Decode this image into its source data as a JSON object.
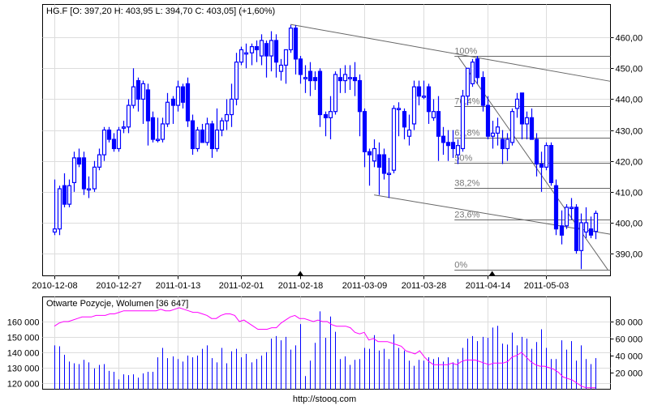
{
  "chart_data": [
    {
      "type": "candlestick",
      "title": "HG.F [O: 397,20  H: 403,95  L: 394,70  C: 403,05] (+1,60%)",
      "x_tick_labels": [
        "2010-12-08",
        "2010-12-27",
        "2011-01-13",
        "2011-02-01",
        "2011-02-18",
        "2011-03-09",
        "2011-03-28",
        "2011-04-14",
        "2011-05-03"
      ],
      "x_tick_index": [
        0,
        13,
        25,
        38,
        50,
        63,
        75,
        88,
        100
      ],
      "y_tick_labels": [
        "460,00",
        "450,00",
        "440,00",
        "430,00",
        "420,00",
        "410,00",
        "400,00",
        "390,00"
      ],
      "y_ticks": [
        460,
        450,
        440,
        430,
        420,
        410,
        400,
        390
      ],
      "ylim": [
        383,
        470
      ],
      "grid": true,
      "ohlc": [
        [
          397,
          414,
          396,
          398
        ],
        [
          398,
          412,
          396,
          411
        ],
        [
          412,
          416,
          405,
          406
        ],
        [
          406,
          414,
          405,
          412
        ],
        [
          413,
          423,
          410,
          421
        ],
        [
          421,
          424,
          418,
          419
        ],
        [
          421,
          423,
          409,
          411
        ],
        [
          411,
          415,
          408,
          411
        ],
        [
          411,
          420,
          410,
          418
        ],
        [
          418,
          424,
          417,
          422
        ],
        [
          422,
          431,
          420,
          430
        ],
        [
          430,
          431,
          426,
          427
        ],
        [
          427,
          429,
          423,
          424
        ],
        [
          424,
          431,
          423,
          430
        ],
        [
          431,
          433,
          429,
          431
        ],
        [
          431,
          440,
          429,
          438
        ],
        [
          438,
          450,
          437,
          444
        ],
        [
          446,
          447,
          436,
          440
        ],
        [
          440,
          446,
          432,
          445
        ],
        [
          443,
          445,
          425,
          433
        ],
        [
          434,
          436,
          426,
          427
        ],
        [
          427,
          434,
          426,
          427
        ],
        [
          427,
          434,
          426,
          432
        ],
        [
          432,
          442,
          431,
          439
        ],
        [
          440,
          441,
          432,
          438
        ],
        [
          438,
          446,
          436,
          444
        ],
        [
          444,
          445,
          437,
          439
        ],
        [
          445,
          447,
          431,
          433
        ],
        [
          433,
          435,
          422,
          424
        ],
        [
          424,
          431,
          423,
          430
        ],
        [
          430,
          432,
          426,
          426
        ],
        [
          426,
          434,
          425,
          432
        ],
        [
          432,
          433,
          421,
          424
        ],
        [
          424,
          437,
          423,
          430
        ],
        [
          430,
          434,
          428,
          433
        ],
        [
          433,
          440,
          430,
          435
        ],
        [
          435,
          445,
          431,
          440
        ],
        [
          440,
          455,
          438,
          452
        ],
        [
          452,
          457,
          451,
          456
        ],
        [
          455,
          458,
          450,
          455
        ],
        [
          455,
          458,
          451,
          457
        ],
        [
          457,
          459,
          452,
          456
        ],
        [
          454,
          461,
          451,
          459
        ],
        [
          458,
          459,
          447,
          454
        ],
        [
          454,
          462,
          449,
          459
        ],
        [
          459,
          461,
          447,
          452
        ],
        [
          449,
          453,
          446,
          451
        ],
        [
          451,
          456,
          445,
          456
        ],
        [
          456,
          464,
          455,
          463
        ],
        [
          463,
          464,
          448,
          453
        ],
        [
          453,
          454,
          445,
          448
        ],
        [
          447,
          451,
          442,
          447
        ],
        [
          449,
          452,
          441,
          446
        ],
        [
          447,
          449,
          443,
          446
        ],
        [
          449,
          450,
          431,
          435
        ],
        [
          435,
          436,
          428,
          434
        ],
        [
          434,
          441,
          427,
          436
        ],
        [
          436,
          449,
          435,
          448
        ],
        [
          447,
          450,
          442,
          446
        ],
        [
          446,
          451,
          442,
          448
        ],
        [
          447,
          451,
          443,
          447
        ],
        [
          447,
          452,
          441,
          446
        ],
        [
          446,
          448,
          428,
          436
        ],
        [
          436,
          437,
          418,
          423
        ],
        [
          423,
          424,
          412,
          422
        ],
        [
          420,
          427,
          418,
          424
        ],
        [
          422,
          426,
          409,
          418
        ],
        [
          422,
          424,
          414,
          416
        ],
        [
          416,
          421,
          408,
          416
        ],
        [
          417,
          438,
          416,
          437
        ],
        [
          437,
          439,
          428,
          437
        ],
        [
          436,
          437,
          427,
          431
        ],
        [
          428,
          435,
          425,
          430
        ],
        [
          432,
          446,
          430,
          444
        ],
        [
          444,
          446,
          438,
          441
        ],
        [
          441,
          446,
          440,
          441
        ],
        [
          444,
          445,
          432,
          436
        ],
        [
          434,
          440,
          433,
          436
        ],
        [
          436,
          441,
          420,
          428
        ],
        [
          428,
          431,
          422,
          426
        ],
        [
          426,
          430,
          420,
          425
        ],
        [
          426,
          430,
          421,
          424
        ],
        [
          422,
          427,
          419,
          425
        ],
        [
          424,
          443,
          423,
          441
        ],
        [
          441,
          449,
          438,
          450
        ],
        [
          445,
          453,
          444,
          452
        ],
        [
          453,
          454,
          445,
          447
        ],
        [
          447,
          449,
          436,
          438
        ],
        [
          438,
          441,
          427,
          428
        ],
        [
          428,
          433,
          424,
          429
        ],
        [
          429,
          434,
          425,
          431
        ],
        [
          427,
          430,
          419,
          424
        ],
        [
          424,
          429,
          420,
          427
        ],
        [
          426,
          437,
          425,
          436
        ],
        [
          437,
          442,
          434,
          440
        ],
        [
          442,
          442,
          427,
          432
        ],
        [
          432,
          436,
          427,
          434
        ],
        [
          434,
          437,
          427,
          427
        ],
        [
          427,
          429,
          415,
          419
        ],
        [
          419,
          423,
          410,
          418
        ],
        [
          418,
          426,
          417,
          425
        ],
        [
          425,
          426,
          412,
          413
        ],
        [
          412,
          414,
          396,
          398
        ],
        [
          399,
          404,
          393,
          396
        ],
        [
          399,
          406,
          398,
          405
        ],
        [
          405,
          408,
          401,
          405
        ],
        [
          405,
          406,
          390,
          391
        ],
        [
          391,
          403,
          385,
          400
        ],
        [
          397,
          405,
          395,
          400
        ],
        [
          398,
          402,
          395,
          396
        ],
        [
          397.2,
          403.95,
          394.7,
          403.05
        ]
      ],
      "trend_lines": [
        {
          "name": "upper-channel",
          "from": [
            48,
            464.2
          ],
          "to": [
            113,
            445.8
          ]
        },
        {
          "name": "lower-channel",
          "from": [
            65,
            409
          ],
          "to": [
            113,
            396.3
          ]
        },
        {
          "name": "fib-diagonal",
          "from": [
            82,
            454
          ],
          "to": [
            112.5,
            384.8
          ]
        }
      ],
      "fibonacci": {
        "from_index": 82,
        "levels": [
          {
            "label": "100%",
            "price": 454
          },
          {
            "label": "76,4%",
            "price": 437.7
          },
          {
            "label": "61,8%",
            "price": 427.6
          },
          {
            "label": "50%",
            "price": 419.4
          },
          {
            "label": "38,2%",
            "price": 411.3
          },
          {
            "label": "23,6%",
            "price": 401.1
          },
          {
            "label": "0%",
            "price": 384.8
          }
        ]
      },
      "markers_index": [
        50,
        89
      ]
    },
    {
      "type": "bar+line",
      "title": "Otwarte Pozycje, Wolumen [36 647]",
      "left_axis": {
        "ticks": [
          160000,
          150000,
          140000,
          130000,
          120000
        ],
        "labels": [
          "160 000",
          "150 000",
          "140 000",
          "130 000",
          "120 000"
        ],
        "range": [
          116000,
          176000
        ]
      },
      "right_axis": {
        "ticks": [
          80000,
          60000,
          40000,
          20000
        ],
        "labels": [
          "80 000",
          "60 000",
          "40 000",
          "20 000"
        ],
        "range": [
          0,
          110000
        ]
      },
      "volume_thousands": [
        52,
        51,
        41,
        33,
        31,
        30,
        35,
        32,
        25,
        29,
        30,
        22,
        21,
        12,
        18,
        17,
        18,
        14,
        19,
        21,
        21,
        38,
        49,
        37,
        39,
        36,
        33,
        40,
        38,
        40,
        48,
        52,
        37,
        32,
        49,
        31,
        45,
        48,
        38,
        42,
        32,
        36,
        40,
        44,
        60,
        63,
        58,
        62,
        47,
        52,
        77,
        16,
        34,
        55,
        92,
        61,
        86,
        68,
        36,
        39,
        29,
        35,
        36,
        49,
        48,
        64,
        46,
        48,
        36,
        65,
        49,
        46,
        34,
        28,
        35,
        34,
        38,
        36,
        38,
        33,
        38,
        32,
        36,
        49,
        60,
        63,
        57,
        62,
        61,
        73,
        75,
        54,
        53,
        67,
        52,
        62,
        60,
        48,
        56,
        71,
        49,
        36,
        36,
        58,
        47,
        57,
        34,
        52,
        36,
        30,
        37
      ],
      "open_interest_thousands": [
        157,
        159,
        160,
        160,
        161,
        162,
        163,
        163,
        163,
        164,
        164,
        164,
        165,
        165,
        166,
        167,
        167,
        167,
        167,
        167,
        167,
        167,
        167,
        168,
        167,
        167,
        168,
        169,
        168,
        167,
        166,
        166,
        165,
        164,
        162,
        162,
        164,
        165,
        165,
        164,
        160,
        161,
        159,
        157,
        155,
        155,
        155,
        156,
        156,
        159,
        161,
        163,
        164,
        162,
        162,
        161,
        160,
        161,
        160,
        160,
        158,
        157,
        157,
        157,
        156,
        153,
        152,
        153,
        148,
        149,
        147,
        147,
        147,
        146,
        145,
        144,
        141,
        140,
        139,
        141,
        137,
        134,
        132,
        132,
        132,
        132,
        133,
        132,
        134,
        135,
        135,
        135,
        134,
        133,
        132,
        133,
        133,
        133,
        134,
        137,
        138,
        140,
        137,
        134,
        132,
        131,
        131,
        130,
        129,
        127,
        124,
        123,
        122,
        120,
        118,
        117,
        117,
        117
      ],
      "colors": {
        "volume": "#0000ff",
        "open_interest": "#ff00ff"
      }
    }
  ],
  "footer": {
    "url": "http://stooq.com"
  },
  "colors": {
    "candle": "#0000ff",
    "grid": "#dddddd",
    "trend": "#666666"
  }
}
